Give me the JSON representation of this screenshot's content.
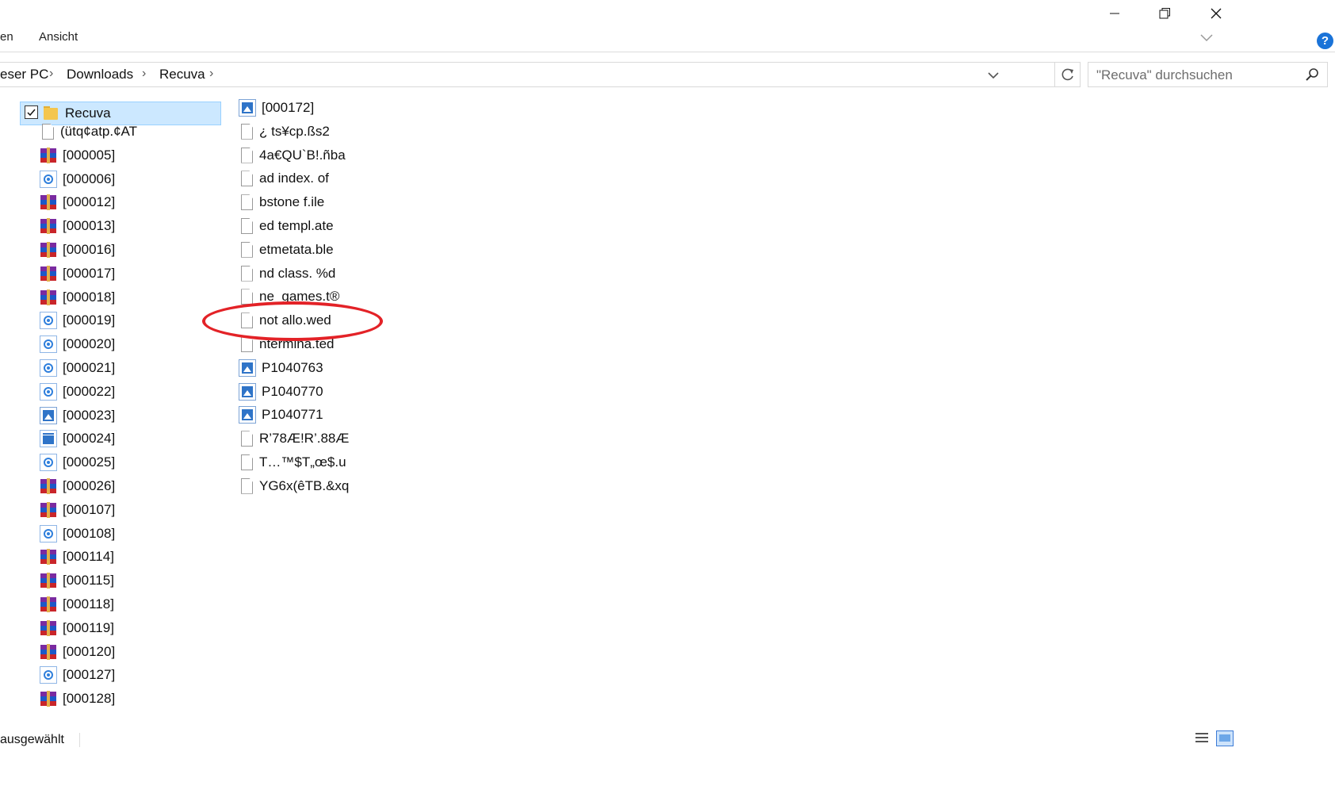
{
  "window": {
    "minimize_glyph": "—",
    "restore_glyph": "❐",
    "close_glyph": "✕"
  },
  "ribbon": {
    "partial_tab": "en",
    "view_tab": "Ansicht",
    "help_label": "?"
  },
  "address": {
    "crumbs": [
      "eser PC",
      "Downloads",
      "Recuva"
    ],
    "separator": "›"
  },
  "search": {
    "placeholder": "\"Recuva\" durchsuchen"
  },
  "tree": {
    "root": {
      "label": "Recuva",
      "icon": "folder-icon",
      "checked": true
    },
    "items": [
      {
        "label": "(ütq¢atp.¢AT",
        "icon": "document-icon"
      },
      {
        "label": "[000005]",
        "icon": "winrar-archive-icon"
      },
      {
        "label": "[000006]",
        "icon": "media-file-icon"
      },
      {
        "label": "[000012]",
        "icon": "winrar-archive-icon"
      },
      {
        "label": "[000013]",
        "icon": "winrar-archive-icon"
      },
      {
        "label": "[000016]",
        "icon": "winrar-archive-icon"
      },
      {
        "label": "[000017]",
        "icon": "winrar-archive-icon"
      },
      {
        "label": "[000018]",
        "icon": "winrar-archive-icon"
      },
      {
        "label": "[000019]",
        "icon": "media-file-icon"
      },
      {
        "label": "[000020]",
        "icon": "media-file-icon"
      },
      {
        "label": "[000021]",
        "icon": "media-file-icon"
      },
      {
        "label": "[000022]",
        "icon": "media-file-icon"
      },
      {
        "label": "[000023]",
        "icon": "image-file-icon"
      },
      {
        "label": "[000024]",
        "icon": "video-file-icon"
      },
      {
        "label": "[000025]",
        "icon": "media-file-icon"
      },
      {
        "label": "[000026]",
        "icon": "winrar-archive-icon"
      },
      {
        "label": "[000107]",
        "icon": "winrar-archive-icon"
      },
      {
        "label": "[000108]",
        "icon": "media-file-icon"
      },
      {
        "label": "[000114]",
        "icon": "winrar-archive-icon"
      },
      {
        "label": "[000115]",
        "icon": "winrar-archive-icon"
      },
      {
        "label": "[000118]",
        "icon": "winrar-archive-icon"
      },
      {
        "label": "[000119]",
        "icon": "winrar-archive-icon"
      },
      {
        "label": "[000120]",
        "icon": "winrar-archive-icon"
      },
      {
        "label": "[000127]",
        "icon": "media-file-icon"
      },
      {
        "label": "[000128]",
        "icon": "winrar-archive-icon"
      }
    ]
  },
  "files": {
    "items": [
      {
        "label": "[000172]",
        "icon": "image-file-icon"
      },
      {
        "label": "¿ ts¥cp.ßs2",
        "icon": "document-icon"
      },
      {
        "label": "4a€QU`B!.ñba",
        "icon": "document-icon"
      },
      {
        "label": "ad index. of",
        "icon": "document-icon"
      },
      {
        "label": "bstone f.ile",
        "icon": "document-icon"
      },
      {
        "label": "ed templ.ate",
        "icon": "document-icon"
      },
      {
        "label": "etmetata.ble",
        "icon": "document-icon"
      },
      {
        "label": "nd class. %d",
        "icon": "document-icon"
      },
      {
        "label": "ne_games.t®",
        "icon": "document-icon"
      },
      {
        "label": "not allo.wed",
        "icon": "document-icon"
      },
      {
        "label": "ntermina.ted",
        "icon": "document-icon"
      },
      {
        "label": "P1040763",
        "icon": "image-file-icon"
      },
      {
        "label": "P1040770",
        "icon": "image-file-icon"
      },
      {
        "label": "P1040771",
        "icon": "image-file-icon"
      },
      {
        "label": "R’78Æ!R’.88Æ",
        "icon": "document-icon"
      },
      {
        "label": "T…™$T„œ$.u",
        "icon": "document-icon"
      },
      {
        "label": "YG6x(êTB.&xq",
        "icon": "document-icon"
      }
    ]
  },
  "highlight": {
    "target": "not allo.wed",
    "color": "#e32227"
  },
  "status": {
    "text": "ausgewählt"
  },
  "colors": {
    "selection": "#cce8ff",
    "accent": "#1a73d8"
  }
}
